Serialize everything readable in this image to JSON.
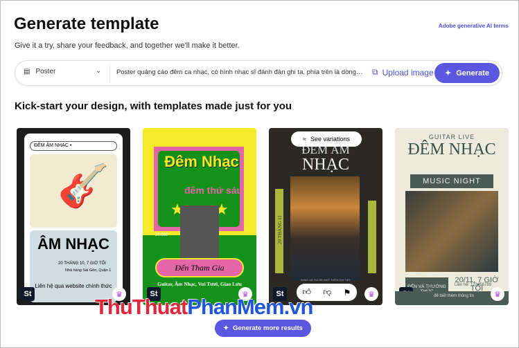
{
  "header": {
    "title": "Generate template",
    "terms_link": "Adobe generative AI terms",
    "subtitle": "Give it a try, share your feedback, and together we'll make it better."
  },
  "prompt_bar": {
    "type_value": "Poster",
    "prompt_value": "Poster quảng cáo đêm ca nhạc, có hình nhạc sĩ đánh đàn ghi ta, phía trên là dòng ch...",
    "upload_label": "Upload image",
    "generate_label": "Generate"
  },
  "section_title": "Kick-start your design, with templates made just for you",
  "cards": [
    {
      "badge": "St",
      "lines": [
        "ĐÊM ÂM NHẠC •",
        "ÂM NHẠC",
        "20 THÁNG 10, 7 GIỜ TỐI",
        "Nhà hàng Sài Gòn, Quận 1",
        "Liên hệ qua website chính thức"
      ]
    },
    {
      "badge": "St",
      "lines": [
        "Đêm Nhạc",
        "đêm thứ sáu",
        "20.000",
        "Đến Tham Gia",
        "Guitar, Âm Nhạc, Vui Tươi, Giao Lưu"
      ]
    },
    {
      "badge": "St",
      "lines": [
        "ĐÊM ÂM",
        "NHẠC",
        "20 THÁNG 11",
        "NHẠC AN VUI ĐỂ BIẾT THÊM CHI TIẾT"
      ],
      "see_variations": "See variations"
    },
    {
      "badge": "St",
      "lines": [
        "GUITAR LIVE",
        "ĐÊM NHẠC",
        "MUSIC NIGHT",
        "ĐẾN VÀ THƯỞNG THỨC",
        "20/11, 7 GIỜ TỐI",
        "Sân khấu Trung Tâm Văn Hóa",
        "Liên hệ: 123456789",
        "để biết thêm thông tin"
      ]
    }
  ],
  "more_button": "Generate more results",
  "watermark": {
    "part1": "ThuThuat",
    "part2": "PhanMem",
    "part3": ".vn"
  },
  "colors": {
    "accent": "#5b57e0",
    "link": "#4b4fd9"
  }
}
